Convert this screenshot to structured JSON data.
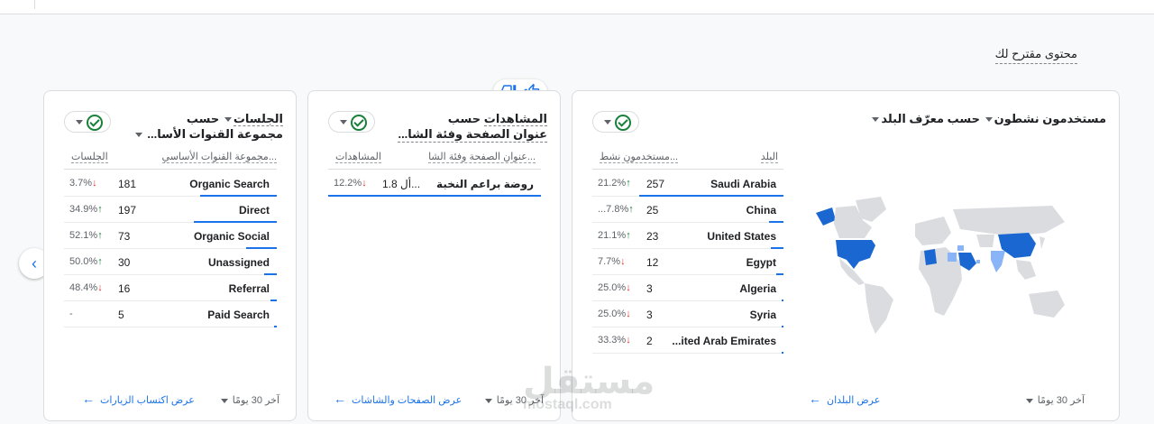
{
  "section_title": "محتوى مقترح لك",
  "cards": {
    "countries": {
      "title_metric": "مستخدمون نشطون",
      "title_by": "حسب معرّف البلد",
      "col_name": "البلد",
      "col_value": "مستخدمون نشط...",
      "rows": [
        {
          "name": "Saudi Arabia",
          "value": "257",
          "pct": "21.2%",
          "dir": "up",
          "share": 1.0
        },
        {
          "name": "China",
          "value": "25",
          "pct": "...7.8%",
          "dir": "up",
          "share": 0.1
        },
        {
          "name": "United States",
          "value": "23",
          "pct": "21.1%",
          "dir": "up",
          "share": 0.09
        },
        {
          "name": "Egypt",
          "value": "12",
          "pct": "7.7%",
          "dir": "down",
          "share": 0.05
        },
        {
          "name": "Algeria",
          "value": "3",
          "pct": "25.0%",
          "dir": "down",
          "share": 0.01
        },
        {
          "name": "Syria",
          "value": "3",
          "pct": "25.0%",
          "dir": "down",
          "share": 0.01
        },
        {
          "name": "...ited Arab Emirates",
          "value": "2",
          "pct": "33.3%",
          "dir": "down",
          "share": 0.01
        }
      ],
      "range": "آخر 30 يومًا",
      "link": "عرض البلدان"
    },
    "pages": {
      "title_metric": "المشاهدات",
      "title_by": "حسب",
      "title_dim": "عنوان الصفحة وفئة الشا...",
      "col_name": "عنوان الصفحة وفئة الشا...",
      "col_value": "المشاهدات",
      "rows": [
        {
          "name": "روضة براعم النخبة",
          "value": "1.8 أل...",
          "pct": "12.2%",
          "dir": "down",
          "share": 1.0
        }
      ],
      "range": "آخر 30 يومًا",
      "link": "عرض الصفحات والشاشات"
    },
    "channels": {
      "title_metric": "الجلسات",
      "title_by": "حسب",
      "title_dim": "مجموعة القنوات الأسا...",
      "col_name": "مجموعة القنوات الأساسي...",
      "col_value": "الجلسات",
      "rows": [
        {
          "name": "Organic Search",
          "value": "181",
          "pct": "3.7%",
          "dir": "down",
          "share": 0.92
        },
        {
          "name": "Direct",
          "value": "197",
          "pct": "34.9%",
          "dir": "up",
          "share": 1.0
        },
        {
          "name": "Organic Social",
          "value": "73",
          "pct": "52.1%",
          "dir": "up",
          "share": 0.37
        },
        {
          "name": "Unassigned",
          "value": "30",
          "pct": "50.0%",
          "dir": "up",
          "share": 0.15
        },
        {
          "name": "Referral",
          "value": "16",
          "pct": "48.4%",
          "dir": "down",
          "share": 0.08
        },
        {
          "name": "Paid Search",
          "value": "5",
          "pct": "-",
          "dir": "none",
          "share": 0.03
        }
      ],
      "range": "آخر 30 يومًا",
      "link": "عرض اكتساب الزيارات"
    }
  },
  "watermark": {
    "ar": "مستقل",
    "en": "mostaql.com"
  },
  "colors": {
    "accent": "#1a73e8",
    "up": "#188038",
    "down": "#d93025",
    "map_dark": "#1a67d2",
    "map_light": "#8ab4f8",
    "map_none": "#dadce0"
  }
}
